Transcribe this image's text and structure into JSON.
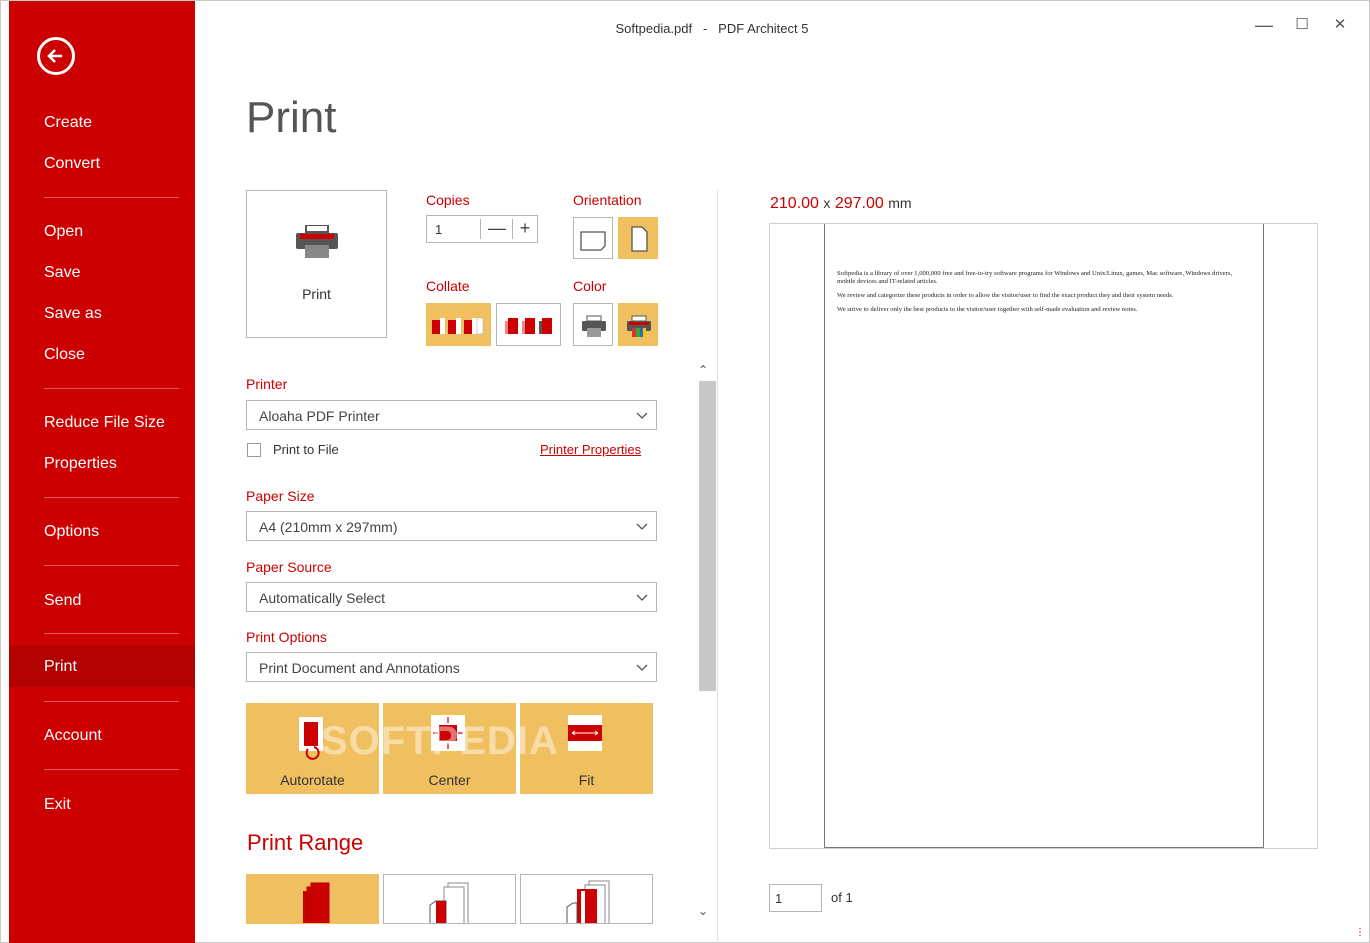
{
  "window": {
    "title_file": "Softpedia.pdf",
    "title_sep": "-",
    "title_app": "PDF Architect 5",
    "minimize": "—",
    "maximize": "☐",
    "close": "✕"
  },
  "sidebar": {
    "items": [
      {
        "label": "Create"
      },
      {
        "label": "Convert"
      },
      {
        "label": "Open"
      },
      {
        "label": "Save"
      },
      {
        "label": "Save as"
      },
      {
        "label": "Close"
      },
      {
        "label": "Reduce File Size"
      },
      {
        "label": "Properties"
      },
      {
        "label": "Options"
      },
      {
        "label": "Send"
      },
      {
        "label": "Print"
      },
      {
        "label": "Account"
      },
      {
        "label": "Exit"
      }
    ],
    "active": "Print"
  },
  "page": {
    "title": "Print",
    "print_button": "Print",
    "copies_label": "Copies",
    "copies_value": "1",
    "copies_minus": "—",
    "copies_plus": "+",
    "orientation_label": "Orientation",
    "collate_label": "Collate",
    "color_label": "Color",
    "printer_label": "Printer",
    "printer_value": "Aloaha PDF Printer",
    "print_to_file": "Print to File",
    "printer_properties": "Printer Properties",
    "paper_size_label": "Paper Size",
    "paper_size_value": "A4 (210mm x 297mm)",
    "paper_source_label": "Paper Source",
    "paper_source_value": "Automatically Select",
    "print_options_label": "Print Options",
    "print_options_value": "Print Document and Annotations",
    "layout_buttons": [
      "Autorotate",
      "Center",
      "Fit"
    ],
    "print_range_title": "Print Range"
  },
  "preview": {
    "width": "210.00",
    "x": "x",
    "height": "297.00",
    "unit": "mm",
    "paragraphs": [
      "Softpedia is a library of over 1,000,000 free and free-to-try software programs for Windows and Unix/Linux, games, Mac software, Windows drivers, mobile devices and IT-related articles.",
      "We review and categorize these products in order to allow the visitor/user to find the exact product they and their system needs.",
      "We strive to deliver only the best products to the visitor/user together with self-made evaluation and review notes."
    ],
    "page_current": "1",
    "page_of": "of 1"
  },
  "watermark": "SOFTPEDIA",
  "colors": {
    "accent": "#cc0000",
    "selected_tile": "#f0c060"
  }
}
